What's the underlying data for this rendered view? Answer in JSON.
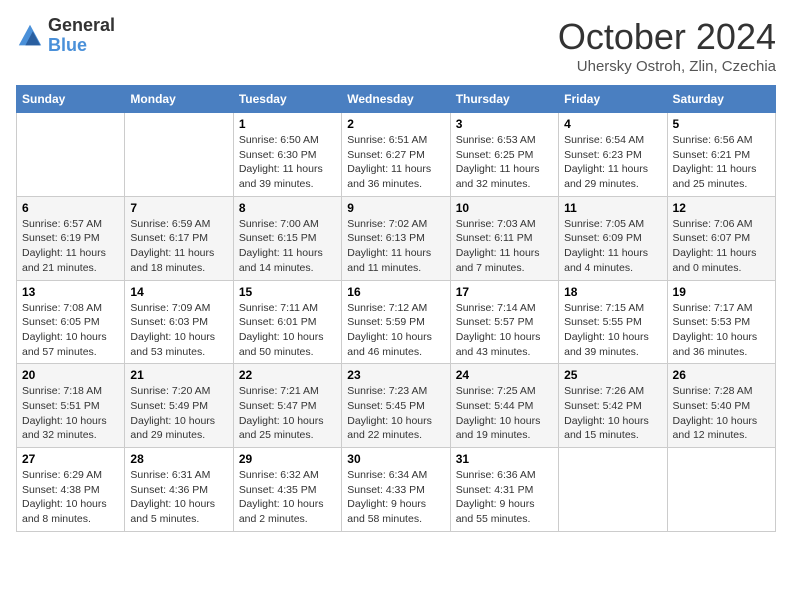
{
  "logo": {
    "general": "General",
    "blue": "Blue"
  },
  "header": {
    "month": "October 2024",
    "location": "Uhersky Ostroh, Zlin, Czechia"
  },
  "days_of_week": [
    "Sunday",
    "Monday",
    "Tuesday",
    "Wednesday",
    "Thursday",
    "Friday",
    "Saturday"
  ],
  "weeks": [
    [
      {
        "day": "",
        "content": ""
      },
      {
        "day": "",
        "content": ""
      },
      {
        "day": "1",
        "content": "Sunrise: 6:50 AM\nSunset: 6:30 PM\nDaylight: 11 hours and 39 minutes."
      },
      {
        "day": "2",
        "content": "Sunrise: 6:51 AM\nSunset: 6:27 PM\nDaylight: 11 hours and 36 minutes."
      },
      {
        "day": "3",
        "content": "Sunrise: 6:53 AM\nSunset: 6:25 PM\nDaylight: 11 hours and 32 minutes."
      },
      {
        "day": "4",
        "content": "Sunrise: 6:54 AM\nSunset: 6:23 PM\nDaylight: 11 hours and 29 minutes."
      },
      {
        "day": "5",
        "content": "Sunrise: 6:56 AM\nSunset: 6:21 PM\nDaylight: 11 hours and 25 minutes."
      }
    ],
    [
      {
        "day": "6",
        "content": "Sunrise: 6:57 AM\nSunset: 6:19 PM\nDaylight: 11 hours and 21 minutes."
      },
      {
        "day": "7",
        "content": "Sunrise: 6:59 AM\nSunset: 6:17 PM\nDaylight: 11 hours and 18 minutes."
      },
      {
        "day": "8",
        "content": "Sunrise: 7:00 AM\nSunset: 6:15 PM\nDaylight: 11 hours and 14 minutes."
      },
      {
        "day": "9",
        "content": "Sunrise: 7:02 AM\nSunset: 6:13 PM\nDaylight: 11 hours and 11 minutes."
      },
      {
        "day": "10",
        "content": "Sunrise: 7:03 AM\nSunset: 6:11 PM\nDaylight: 11 hours and 7 minutes."
      },
      {
        "day": "11",
        "content": "Sunrise: 7:05 AM\nSunset: 6:09 PM\nDaylight: 11 hours and 4 minutes."
      },
      {
        "day": "12",
        "content": "Sunrise: 7:06 AM\nSunset: 6:07 PM\nDaylight: 11 hours and 0 minutes."
      }
    ],
    [
      {
        "day": "13",
        "content": "Sunrise: 7:08 AM\nSunset: 6:05 PM\nDaylight: 10 hours and 57 minutes."
      },
      {
        "day": "14",
        "content": "Sunrise: 7:09 AM\nSunset: 6:03 PM\nDaylight: 10 hours and 53 minutes."
      },
      {
        "day": "15",
        "content": "Sunrise: 7:11 AM\nSunset: 6:01 PM\nDaylight: 10 hours and 50 minutes."
      },
      {
        "day": "16",
        "content": "Sunrise: 7:12 AM\nSunset: 5:59 PM\nDaylight: 10 hours and 46 minutes."
      },
      {
        "day": "17",
        "content": "Sunrise: 7:14 AM\nSunset: 5:57 PM\nDaylight: 10 hours and 43 minutes."
      },
      {
        "day": "18",
        "content": "Sunrise: 7:15 AM\nSunset: 5:55 PM\nDaylight: 10 hours and 39 minutes."
      },
      {
        "day": "19",
        "content": "Sunrise: 7:17 AM\nSunset: 5:53 PM\nDaylight: 10 hours and 36 minutes."
      }
    ],
    [
      {
        "day": "20",
        "content": "Sunrise: 7:18 AM\nSunset: 5:51 PM\nDaylight: 10 hours and 32 minutes."
      },
      {
        "day": "21",
        "content": "Sunrise: 7:20 AM\nSunset: 5:49 PM\nDaylight: 10 hours and 29 minutes."
      },
      {
        "day": "22",
        "content": "Sunrise: 7:21 AM\nSunset: 5:47 PM\nDaylight: 10 hours and 25 minutes."
      },
      {
        "day": "23",
        "content": "Sunrise: 7:23 AM\nSunset: 5:45 PM\nDaylight: 10 hours and 22 minutes."
      },
      {
        "day": "24",
        "content": "Sunrise: 7:25 AM\nSunset: 5:44 PM\nDaylight: 10 hours and 19 minutes."
      },
      {
        "day": "25",
        "content": "Sunrise: 7:26 AM\nSunset: 5:42 PM\nDaylight: 10 hours and 15 minutes."
      },
      {
        "day": "26",
        "content": "Sunrise: 7:28 AM\nSunset: 5:40 PM\nDaylight: 10 hours and 12 minutes."
      }
    ],
    [
      {
        "day": "27",
        "content": "Sunrise: 6:29 AM\nSunset: 4:38 PM\nDaylight: 10 hours and 8 minutes."
      },
      {
        "day": "28",
        "content": "Sunrise: 6:31 AM\nSunset: 4:36 PM\nDaylight: 10 hours and 5 minutes."
      },
      {
        "day": "29",
        "content": "Sunrise: 6:32 AM\nSunset: 4:35 PM\nDaylight: 10 hours and 2 minutes."
      },
      {
        "day": "30",
        "content": "Sunrise: 6:34 AM\nSunset: 4:33 PM\nDaylight: 9 hours and 58 minutes."
      },
      {
        "day": "31",
        "content": "Sunrise: 6:36 AM\nSunset: 4:31 PM\nDaylight: 9 hours and 55 minutes."
      },
      {
        "day": "",
        "content": ""
      },
      {
        "day": "",
        "content": ""
      }
    ]
  ]
}
